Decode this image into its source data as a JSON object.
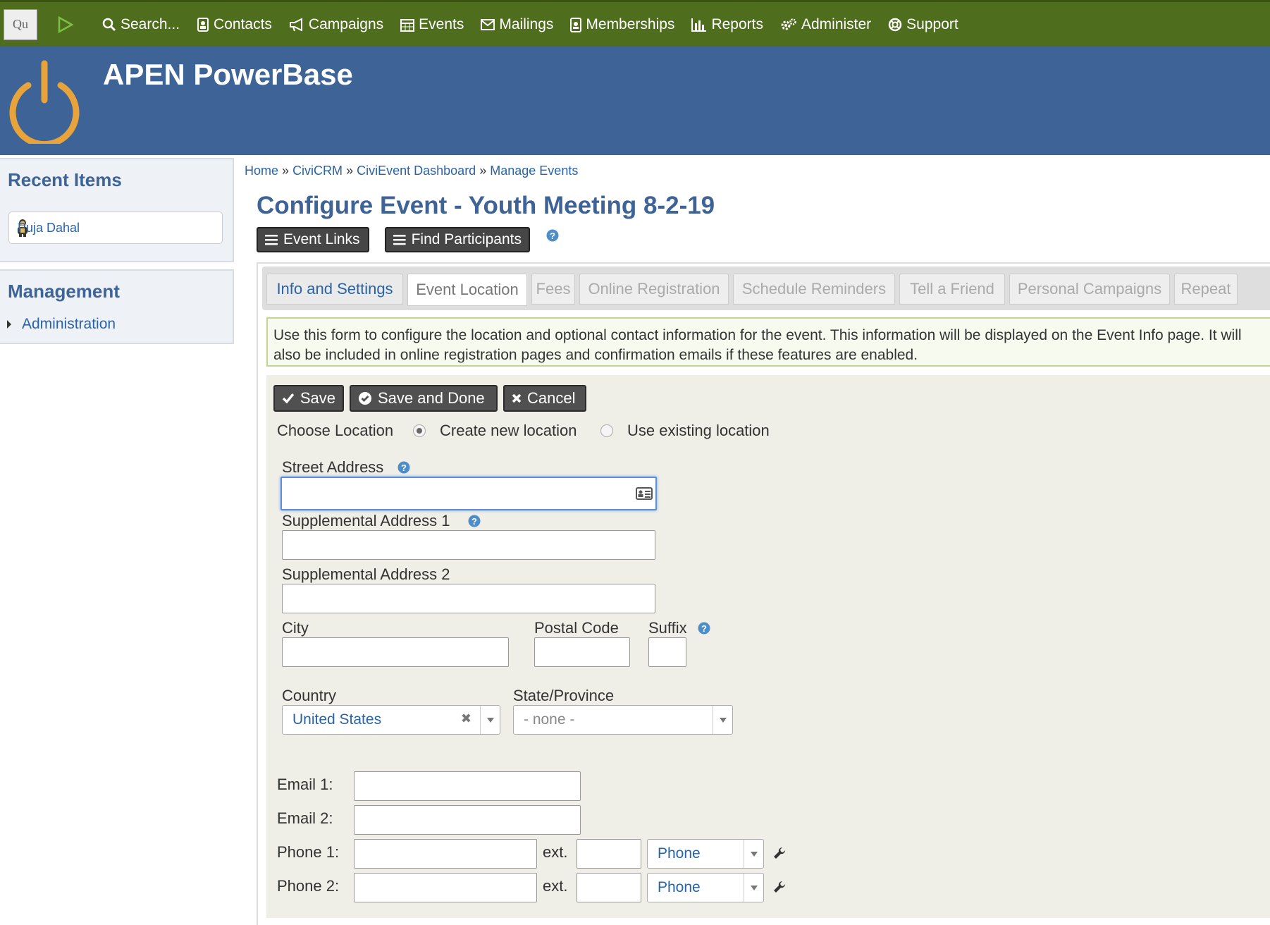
{
  "nav": {
    "quick_search": "Qu",
    "items": [
      {
        "label": "Search...",
        "icon": "search-icon"
      },
      {
        "label": "Contacts",
        "icon": "contacts-icon"
      },
      {
        "label": "Campaigns",
        "icon": "bullhorn-icon"
      },
      {
        "label": "Events",
        "icon": "calendar-icon"
      },
      {
        "label": "Mailings",
        "icon": "envelope-icon"
      },
      {
        "label": "Memberships",
        "icon": "id-badge-icon"
      },
      {
        "label": "Reports",
        "icon": "bar-chart-icon"
      },
      {
        "label": "Administer",
        "icon": "gears-icon"
      },
      {
        "label": "Support",
        "icon": "life-ring-icon"
      }
    ]
  },
  "site": {
    "title": "APEN PowerBase"
  },
  "sidebar": {
    "recent_title": "Recent Items",
    "recent_items": [
      {
        "label": "Puja Dahal"
      }
    ],
    "management_title": "Management",
    "management_items": [
      {
        "label": "Administration"
      }
    ]
  },
  "breadcrumb": [
    "Home",
    "CiviCRM",
    "CiviEvent Dashboard",
    "Manage Events"
  ],
  "breadcrumb_sep": "»",
  "page_title": "Configure Event - Youth Meeting 8-2-19",
  "top_buttons": {
    "event_links": "Event Links",
    "find_participants": "Find Participants"
  },
  "tabs": [
    {
      "label": "Info and Settings",
      "state": "linked"
    },
    {
      "label": "Event Location",
      "state": "active"
    },
    {
      "label": "Fees",
      "state": "disabled"
    },
    {
      "label": "Online Registration",
      "state": "disabled"
    },
    {
      "label": "Schedule Reminders",
      "state": "disabled"
    },
    {
      "label": "Tell a Friend",
      "state": "disabled"
    },
    {
      "label": "Personal Campaigns",
      "state": "disabled"
    },
    {
      "label": "Repeat",
      "state": "disabled"
    }
  ],
  "help_text": "Use this form to configure the location and optional contact information for the event. This information will be displayed on the Event Info page. It will also be included in online registration pages and confirmation emails if these features are enabled.",
  "actions": {
    "save": "Save",
    "save_done": "Save and Done",
    "cancel": "Cancel"
  },
  "form": {
    "choose_location_label": "Choose Location",
    "option_new": "Create new location",
    "option_existing": "Use existing location",
    "street_address_label": "Street Address",
    "street_address_value": "",
    "supp1_label": "Supplemental Address 1",
    "supp1_value": "",
    "supp2_label": "Supplemental Address 2",
    "supp2_value": "",
    "city_label": "City",
    "city_value": "",
    "postal_label": "Postal Code",
    "postal_value": "",
    "suffix_label": "Suffix",
    "suffix_value": "",
    "country_label": "Country",
    "country_value": "United States",
    "state_label": "State/Province",
    "state_value": "- none -",
    "email1_label": "Email 1:",
    "email2_label": "Email 2:",
    "phone1_label": "Phone 1:",
    "phone2_label": "Phone 2:",
    "ext_label": "ext.",
    "phone_type_1": "Phone",
    "phone_type_2": "Phone"
  },
  "colors": {
    "nav_bg": "#4e6d1d",
    "banner_bg": "#3e6397",
    "logo_orange": "#e8a33a",
    "link_blue": "#2a63a6"
  }
}
